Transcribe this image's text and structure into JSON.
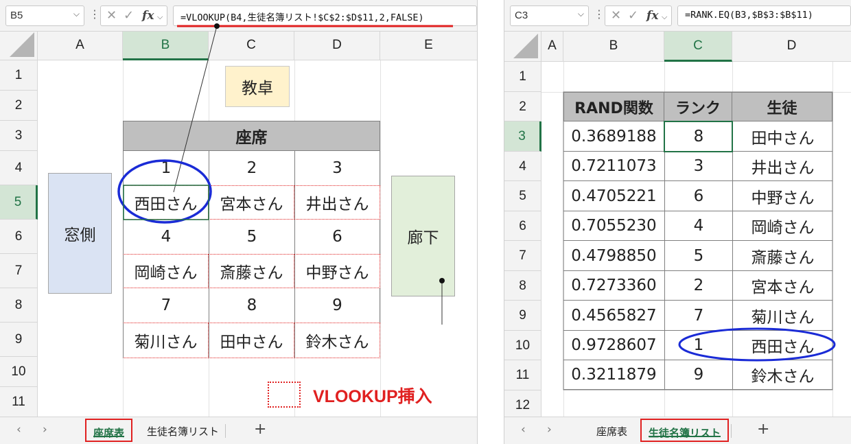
{
  "left": {
    "name_box": "B5",
    "formula": "=VLOOKUP(B4,生徒名簿リスト!$C$2:$D$11,2,FALSE)",
    "columns": [
      "A",
      "B",
      "C",
      "D",
      "E"
    ],
    "rows": [
      "1",
      "2",
      "3",
      "4",
      "5",
      "6",
      "7",
      "8",
      "9",
      "10",
      "11"
    ],
    "teacher_desk": "教卓",
    "seat_header": "座席",
    "seats": [
      {
        "numbers": [
          "1",
          "2",
          "3"
        ],
        "names": [
          "西田さん",
          "宮本さん",
          "井出さん"
        ]
      },
      {
        "numbers": [
          "4",
          "5",
          "6"
        ],
        "names": [
          "岡崎さん",
          "斎藤さん",
          "中野さん"
        ]
      },
      {
        "numbers": [
          "7",
          "8",
          "9"
        ],
        "names": [
          "菊川さん",
          "田中さん",
          "鈴木さん"
        ]
      }
    ],
    "window_side": "窓側",
    "hallway": "廊下",
    "legend_label": "VLOOKUP挿入",
    "tabs": [
      "座席表",
      "生徒名簿リスト"
    ],
    "active_tab": "座席表",
    "plus": "+"
  },
  "right": {
    "name_box": "C3",
    "formula": "=RANK.EQ(B3,$B$3:$B$11)",
    "columns": [
      "A",
      "B",
      "C",
      "D"
    ],
    "rows": [
      "1",
      "2",
      "3",
      "4",
      "5",
      "6",
      "7",
      "8",
      "9",
      "10",
      "11",
      "12"
    ],
    "headers": [
      "RAND関数",
      "ランク",
      "生徒"
    ],
    "table": [
      [
        "0.3689188",
        "8",
        "田中さん"
      ],
      [
        "0.7211073",
        "3",
        "井出さん"
      ],
      [
        "0.4705221",
        "6",
        "中野さん"
      ],
      [
        "0.7055230",
        "4",
        "岡崎さん"
      ],
      [
        "0.4798850",
        "5",
        "斎藤さん"
      ],
      [
        "0.7273360",
        "2",
        "宮本さん"
      ],
      [
        "0.4565827",
        "7",
        "菊川さん"
      ],
      [
        "0.9728607",
        "1",
        "西田さん"
      ],
      [
        "0.3211879",
        "9",
        "鈴木さん"
      ]
    ],
    "tabs": [
      "座席表",
      "生徒名簿リスト"
    ],
    "active_tab": "生徒名簿リスト",
    "plus": "+"
  },
  "colors": {
    "accent_green": "#217346",
    "annotation_red": "#e02020",
    "annotation_blue": "#1a2bd6",
    "teacher_fill": "#fff2cc",
    "window_fill": "#dae3f3",
    "hall_fill": "#e2efda",
    "header_fill": "#bfbfbf"
  },
  "icons": [
    "cancel-icon",
    "enter-check-icon",
    "function-fx-icon",
    "chevron-down-icon",
    "more-options-icon",
    "select-all-corner-icon",
    "nav-left-icon",
    "nav-right-icon",
    "add-sheet-icon"
  ]
}
